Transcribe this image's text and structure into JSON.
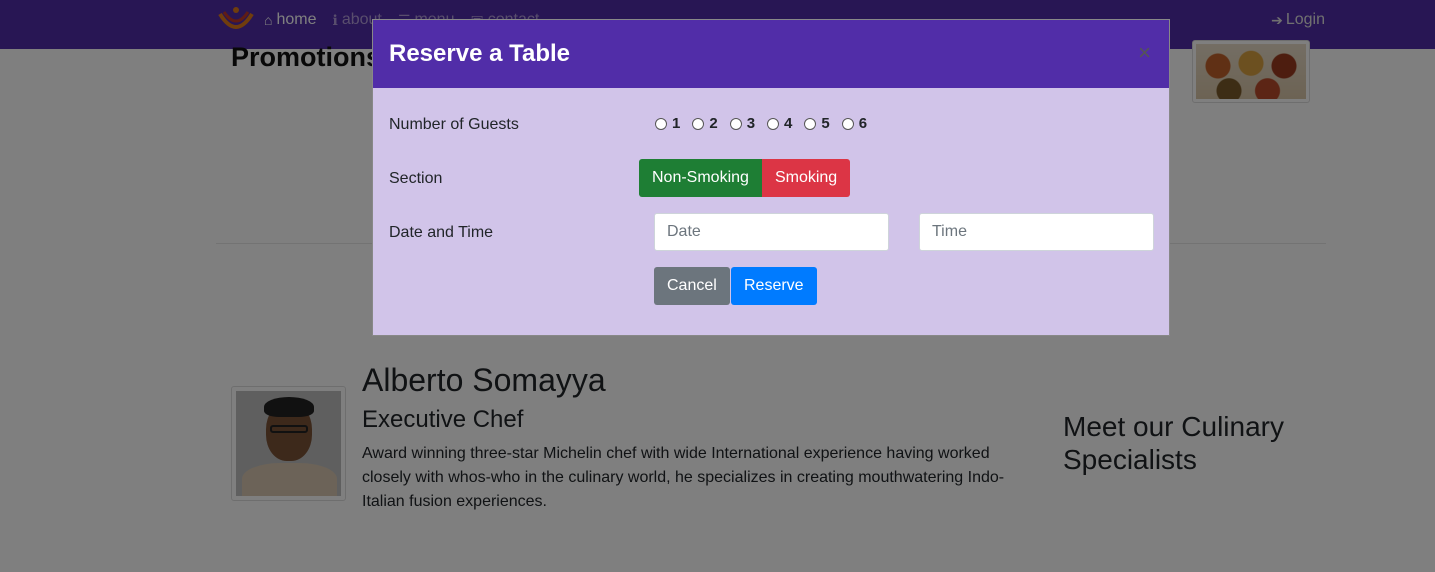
{
  "navbar": {
    "links": [
      {
        "icon": "home-icon",
        "glyph": "⌂",
        "label": "home"
      },
      {
        "icon": "info-icon",
        "glyph": "ℹ",
        "label": "about"
      },
      {
        "icon": "list-icon",
        "glyph": "☰",
        "label": "menu"
      },
      {
        "icon": "address-card-icon",
        "glyph": "▣",
        "label": "contact"
      }
    ],
    "login": {
      "icon": "sign-in-icon",
      "glyph": "➔",
      "label": "Login"
    }
  },
  "page": {
    "promotions_heading": "Promotions",
    "leader": {
      "name": "Alberto Somayya",
      "title": "Executive Chef",
      "description": "Award winning three-star Michelin chef with wide International experience having worked closely with whos-who in the culinary world, he specializes in creating mouthwatering Indo-Italian fusion experiences."
    },
    "meet_heading": "Meet our Culinary Specialists"
  },
  "modal": {
    "title": "Reserve a Table",
    "close_glyph": "×",
    "guests_label": "Number of Guests",
    "guest_options": [
      "1",
      "2",
      "3",
      "4",
      "5",
      "6"
    ],
    "section_label": "Section",
    "section_options": {
      "non_smoking": "Non-Smoking",
      "smoking": "Smoking"
    },
    "datetime_label": "Date and Time",
    "date_placeholder": "Date",
    "time_placeholder": "Time",
    "cancel_label": "Cancel",
    "reserve_label": "Reserve"
  },
  "colors": {
    "brand": "#512da8",
    "modal_body": "#d1c4e9",
    "non_smoking": "#1e7e34",
    "smoking": "#dc3545",
    "cancel": "#6c757d",
    "reserve": "#007bff"
  }
}
